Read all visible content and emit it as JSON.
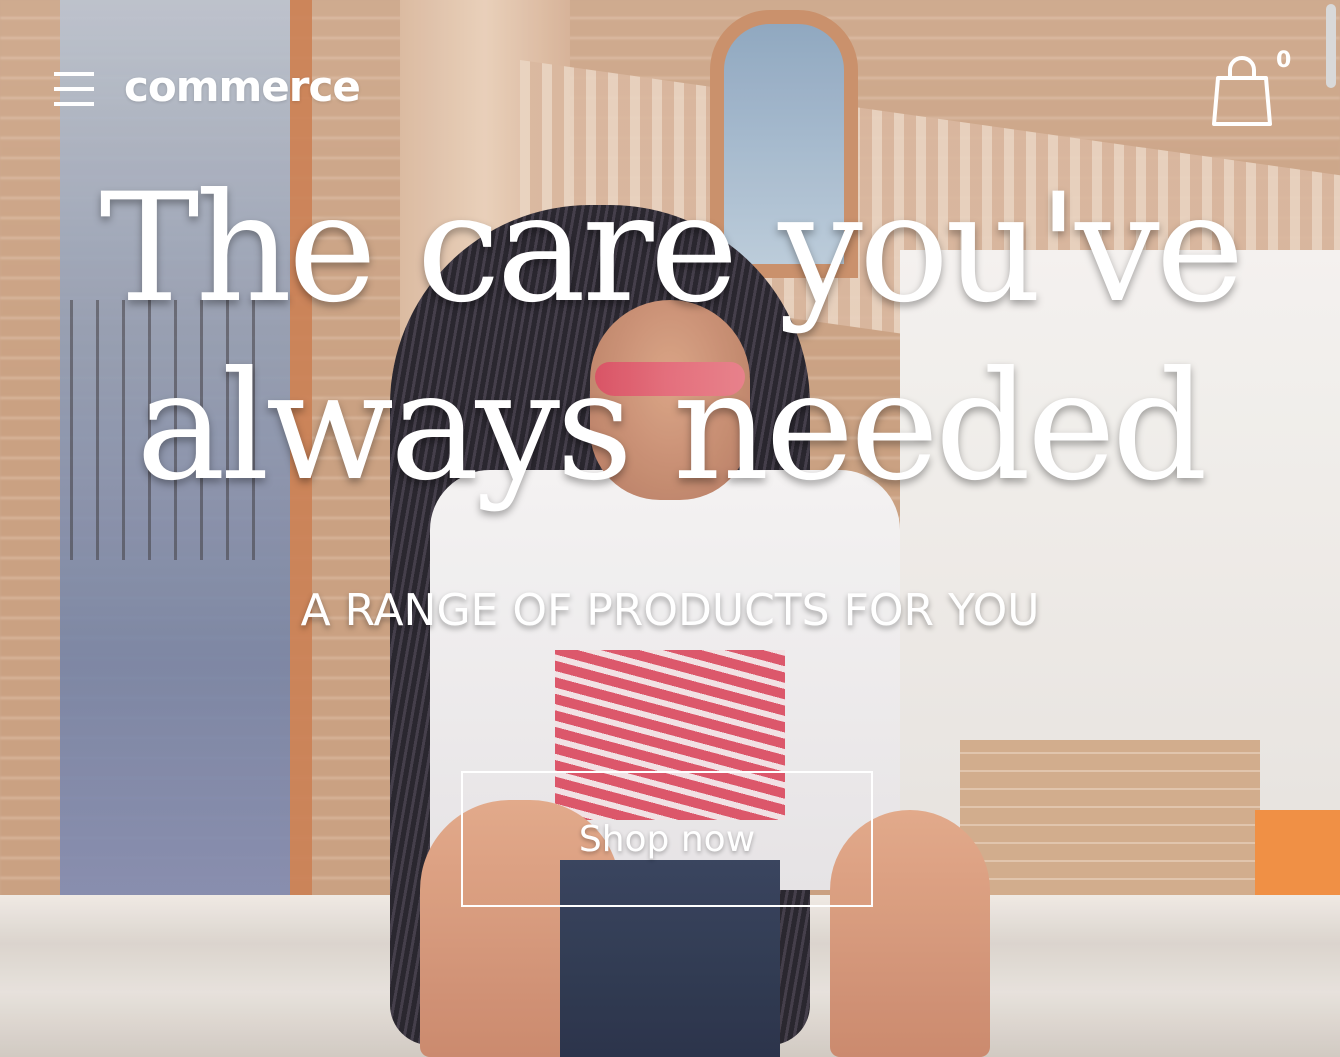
{
  "header": {
    "brand": "commerce",
    "menu_icon": "hamburger-menu-icon",
    "cart_icon": "shopping-bag-icon",
    "cart_count": "0"
  },
  "hero": {
    "headline_line1": "The care you've",
    "headline_line2": "always needed",
    "subheading": "A RANGE OF PRODUCTS FOR YOU",
    "cta_label": "Shop now"
  },
  "colors": {
    "text": "#ffffff",
    "cta_border": "#ffffff"
  }
}
